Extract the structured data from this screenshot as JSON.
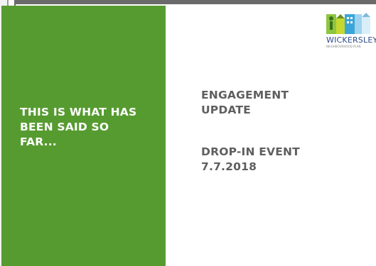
{
  "green_panel": {
    "heading": "THIS IS WHAT HAS\nBEEN SAID SO\nFAR..."
  },
  "content": {
    "engagement_title": "ENGAGEMENT\nUPDATE",
    "event_title": "DROP-IN EVENT\n7.7.2018"
  },
  "logo": {
    "name": "WICKERSLEY",
    "subtitle": "NEIGHBOURHOOD PLAN",
    "icon": "wickersley-logo-icon"
  },
  "colors": {
    "panel_green": "#569b30",
    "text_gray": "#5f5f5f",
    "logo_blue": "#2e4a8a"
  }
}
